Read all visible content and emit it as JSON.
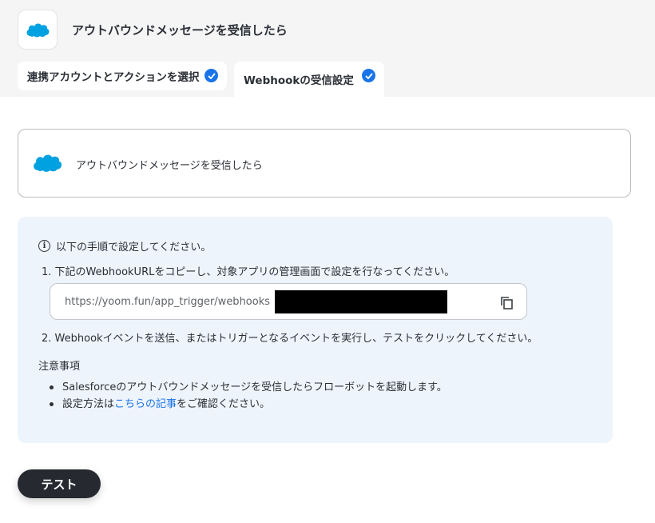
{
  "header": {
    "title": "アウトバウンドメッセージを受信したら",
    "logo_icon": "salesforce-cloud-icon",
    "brand_color": "#00a1e0"
  },
  "tabs": [
    {
      "label": "連携アカウントとアクションを選択",
      "completed": true
    },
    {
      "label": "Webhookの受信設定",
      "completed": true
    }
  ],
  "trigger_card": {
    "label": "アウトバウンドメッセージを受信したら",
    "icon": "salesforce-cloud-icon"
  },
  "instructions": {
    "heading": "以下の手順で設定してください。",
    "step1": "1. 下記のWebhookURLをコピーし、対象アプリの管理画面で設定を行なってください。",
    "url": "https://yoom.fun/app_trigger/webhooks",
    "copy_icon": "copy-icon",
    "step2": "2. Webhookイベントを送信、またはトリガーとなるイベントを実行し、テストをクリックしてください。"
  },
  "notes": {
    "title": "注意事項",
    "item1": "Salesforceのアウトバウンドメッセージを受信したらフローボットを起動します。",
    "item2_prefix": "設定方法は",
    "item2_link": "こちらの記事",
    "item2_suffix": "をご確認ください。"
  },
  "actions": {
    "test_label": "テスト"
  },
  "colors": {
    "accent": "#1a73e8",
    "info_bg": "#eef4fc",
    "dark_button": "#262a30"
  }
}
